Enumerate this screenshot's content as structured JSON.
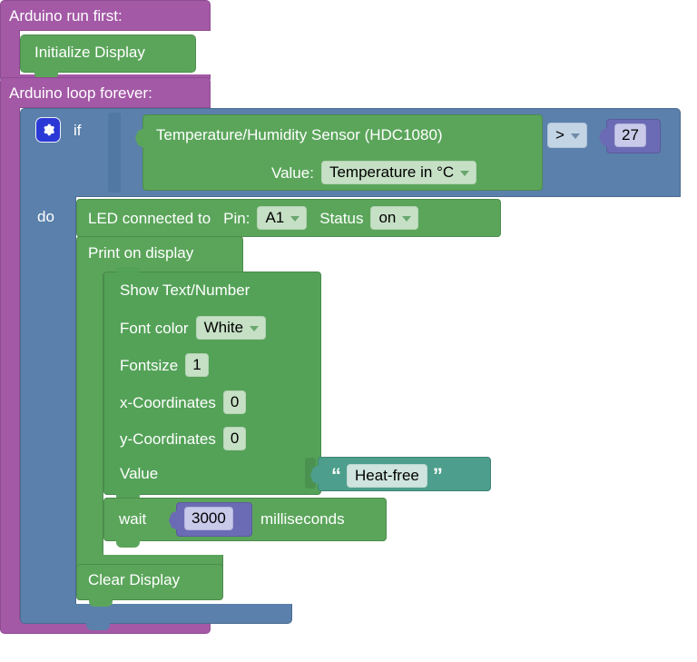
{
  "workspace": {
    "setup_block": {
      "label": "Arduino run first:"
    },
    "loop_block": {
      "label": "Arduino loop forever:"
    },
    "init_display": {
      "label": "Initialize Display"
    },
    "if_block": {
      "gear_icon": "gear-icon",
      "if_label": "if",
      "do_label": "do"
    },
    "sensor_block": {
      "title": "Temperature/Humidity Sensor (HDC1080)",
      "value_label": "Value:",
      "value_selected": "Temperature in °C"
    },
    "compare_block": {
      "operator": ">"
    },
    "threshold_number": {
      "value": "27"
    },
    "led_block": {
      "label": "LED connected to",
      "pin_label": "Pin:",
      "pin_value": "A1",
      "status_label": "Status",
      "status_value": "on"
    },
    "print_display_block": {
      "label": "Print on display"
    },
    "show_text_block": {
      "title": "Show Text/Number",
      "font_color_label": "Font color",
      "font_color_value": "White",
      "fontsize_label": "Fontsize",
      "fontsize_value": "1",
      "x_label": "x-Coordinates",
      "x_value": "0",
      "y_label": "y-Coordinates",
      "y_value": "0",
      "value_label": "Value"
    },
    "text_string_block": {
      "open_quote": "“",
      "text": "Heat-free",
      "close_quote": "”"
    },
    "wait_block": {
      "label": "wait",
      "number": "3000",
      "unit": "milliseconds"
    },
    "clear_display_block": {
      "label": "Clear Display"
    }
  },
  "colors": {
    "event_purple": "#a359a6",
    "control_blue": "#5a80ab",
    "action_green": "#5ba55b",
    "text_teal": "#4d9e8c",
    "math_indigo": "#6b6bb5",
    "gear_blue": "#2a39d6",
    "field_green": "#c6e0c6"
  }
}
